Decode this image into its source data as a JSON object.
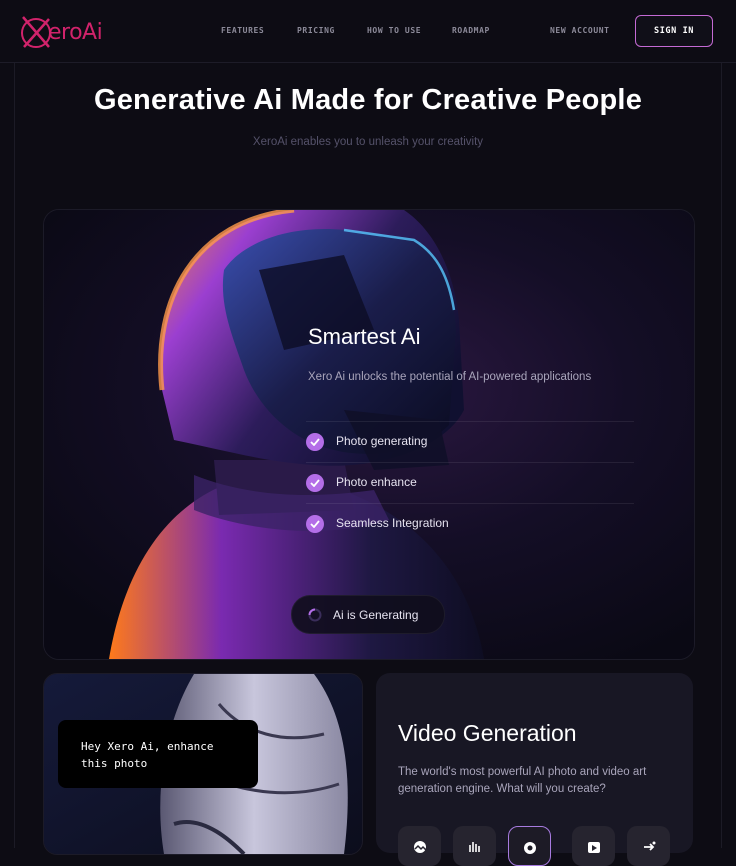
{
  "brand": {
    "name": "XeroAi",
    "logo_letter": "X",
    "logo_rest": "eroAi",
    "accent": "#d1236b"
  },
  "nav": {
    "items": [
      "FEATURES",
      "PRICING",
      "HOW TO USE",
      "ROADMAP"
    ],
    "new_account": "NEW ACCOUNT",
    "sign_in": "SIGN IN"
  },
  "hero": {
    "title": "Generative Ai Made for Creative People",
    "subtitle": "XeroAi enables you to unleash your creativity"
  },
  "smart_card": {
    "title": "Smartest Ai",
    "description": "Xero Ai unlocks the potential of AI-powered applications",
    "features": [
      "Photo generating",
      "Photo enhance",
      "Seamless Integration"
    ],
    "status": "Ai is Generating"
  },
  "chat": {
    "message": "Hey Xero Ai, enhance\nthis photo"
  },
  "video_card": {
    "title": "Video Generation",
    "description": "The world's most powerful AI photo and video art generation engine. What will you create?",
    "tools": [
      "image-icon",
      "audio-wave-icon",
      "chat-icon",
      "play-icon",
      "share-icon"
    ]
  },
  "colors": {
    "background": "#0d0c14",
    "check": "#b46ee8",
    "signin_border": "#c46ad4"
  }
}
